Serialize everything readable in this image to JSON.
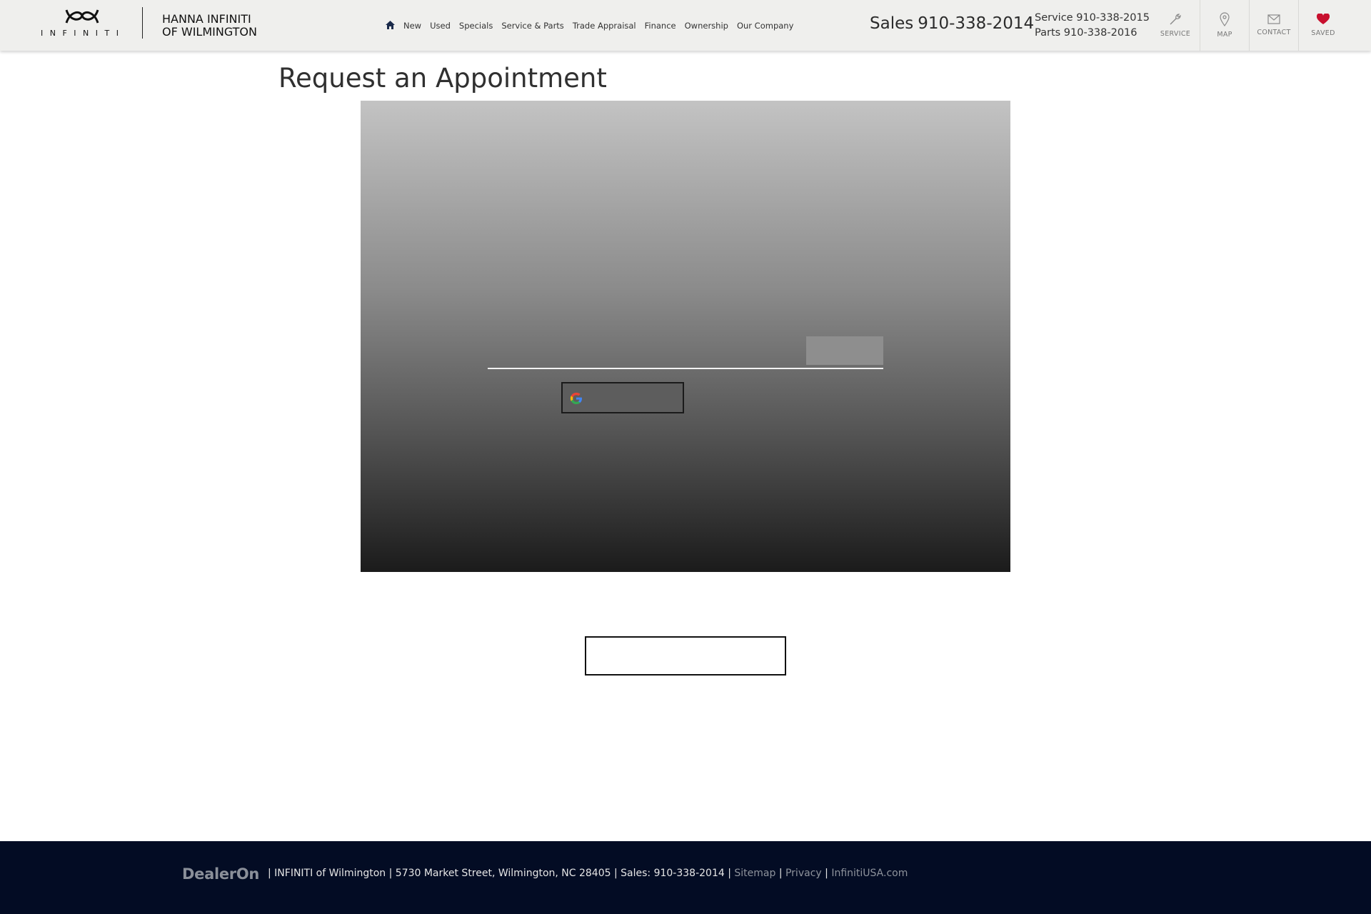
{
  "header": {
    "brand_wordmark": "INFINITI",
    "dealer_line1": "HANNA INFINITI",
    "dealer_line2": "OF WILMINGTON",
    "nav": [
      "New",
      "Used",
      "Specials",
      "Service & Parts",
      "Trade Appraisal",
      "Finance",
      "Ownership",
      "Our Company"
    ],
    "sales_label": "Sales",
    "sales_phone": "910-338-2014",
    "service_line": "Service 910-338-2015",
    "parts_line": "Parts 910-338-2016",
    "quick_links": [
      "SERVICE",
      "MAP",
      "CONTACT",
      "SAVED"
    ],
    "icons": {
      "home": "home-icon",
      "service": "wrench-icon",
      "map": "map-pin-icon",
      "contact": "envelope-icon",
      "saved": "heart-icon"
    },
    "colors": {
      "saved_heart": "#c8102e",
      "header_bg": "#efefed"
    }
  },
  "main": {
    "title": "Request an Appointment",
    "embed": {
      "google_icon": "google-icon"
    }
  },
  "footer": {
    "logo_text": "DealerOn",
    "info": "| INFINITI of Wilmington | 5730 Market Street, Wilmington, NC 28405 | Sales: 910-338-2014 |",
    "sitemap": "Sitemap",
    "privacy": "Privacy",
    "infiniti_usa": "InfinitiUSA.com",
    "sep": "|",
    "colors": {
      "bg": "#030c24"
    }
  }
}
